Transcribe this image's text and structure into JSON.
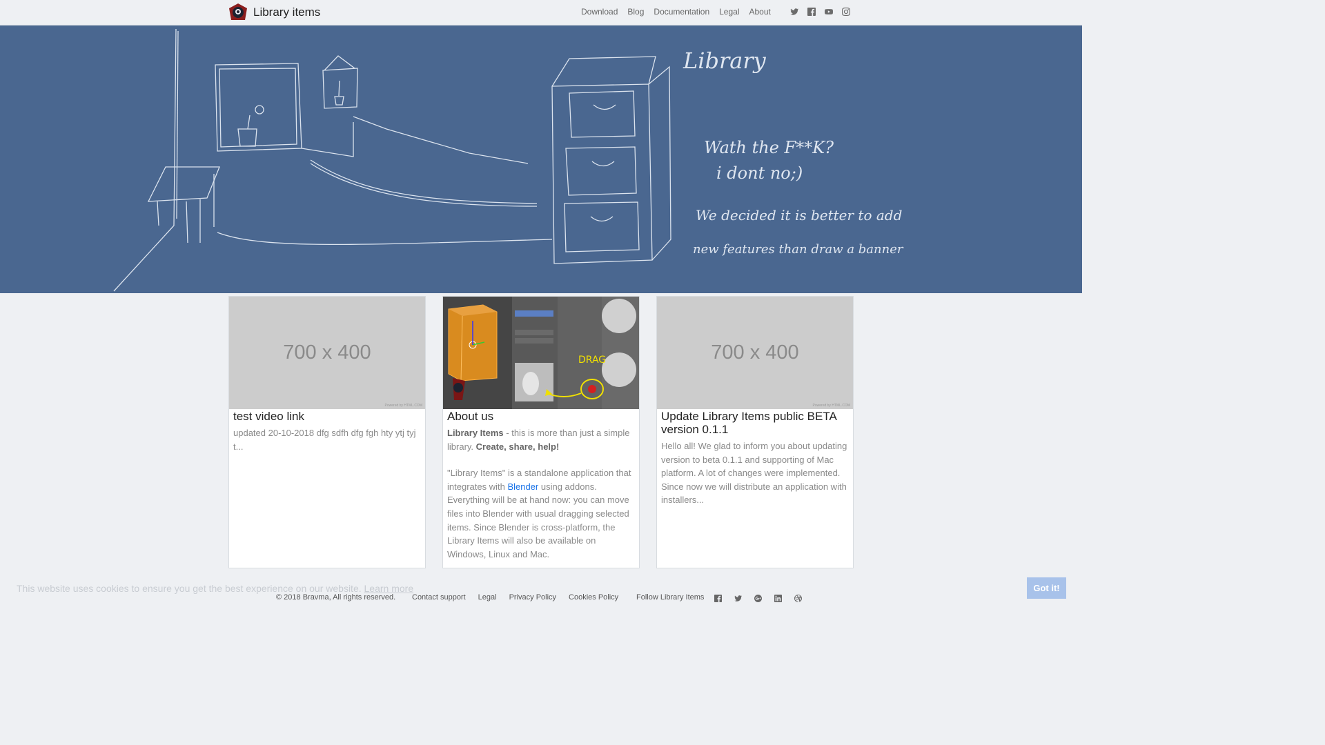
{
  "navbar": {
    "brand": "Library items",
    "links": [
      "Download",
      "Blog",
      "Documentation",
      "Legal",
      "About"
    ],
    "social": [
      "twitter-icon",
      "facebook-icon",
      "youtube-icon",
      "instagram-icon"
    ]
  },
  "banner": {
    "lines": [
      "Library",
      "Wath the F**K?",
      "i dont no;)",
      "We decided it is better to add",
      "new features than draw a banner"
    ]
  },
  "cards": [
    {
      "placeholder": "700 x 400",
      "watermark": "Powered by HTML.COM",
      "title": "test video link",
      "text": "updated 20-10-2018 dfg sdfh dfg fgh hty ytj tyj t..."
    },
    {
      "title": "About us",
      "intro_bold": "Library Items",
      "intro_rest": " - this is more than just a simple library. ",
      "intro_tag": "Create, share, help!",
      "body_a": "\"Library Items\" is a standalone application that integrates with ",
      "body_link": "Blender",
      "body_b": " using addons. Everything will be at hand now: you can move files into Blender with usual dragging selected items. Since Blender is cross-platform, the Library Items will also be available on Windows, Linux and Mac.",
      "image_label": "DRAG"
    },
    {
      "placeholder": "700 x 400",
      "watermark": "Powered by HTML.COM",
      "title": "Update Library Items public BETA version 0.1.1",
      "text": "Hello all! We glad to inform you about updating version to beta 0.1.1 and supporting of Mac platform. A lot of changes were implemented. Since now we will distribute an application with installers..."
    }
  ],
  "cookie": {
    "text": "This website uses cookies to ensure you get the best experience on our website.",
    "learn_more": "Learn more",
    "button": "Got it!"
  },
  "footer": {
    "copyright": "© 2018 Bravma, All rights reserved.",
    "links": [
      "Contact support",
      "Legal",
      "Privacy Policy",
      "Cookies Policy"
    ],
    "follow": "Follow Library Items",
    "social": [
      "facebook-icon",
      "twitter-icon",
      "google-plus-icon",
      "linkedin-icon",
      "dribbble-icon"
    ]
  },
  "colors": {
    "banner": "#4a6790",
    "navbar": "#eef0f3",
    "cookie_button": "#a8c2ea",
    "link": "#1a73e8"
  }
}
